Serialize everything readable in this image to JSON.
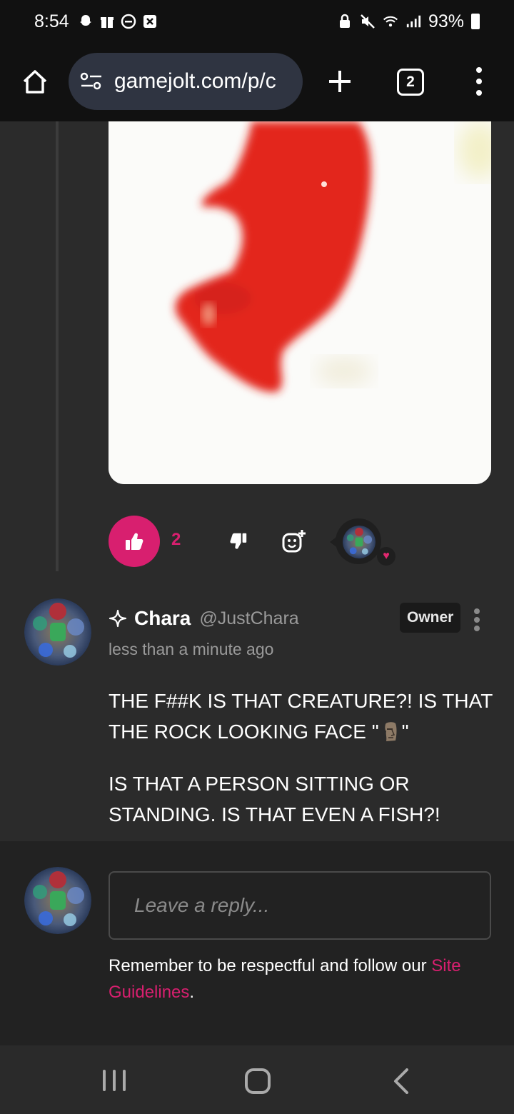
{
  "status_bar": {
    "time": "8:54",
    "left_icons": [
      "snapchat-icon",
      "gift-icon",
      "dnd-icon",
      "close-box-icon"
    ],
    "right_icons": [
      "lock-icon",
      "mute-icon",
      "wifi-icon",
      "signal-icon"
    ],
    "battery": "93%"
  },
  "browser": {
    "url": "gamejolt.com/p/c",
    "tab_count": "2"
  },
  "post": {
    "like_count": "2",
    "accent_color": "#d81f6f"
  },
  "comment": {
    "author_name": "Chara",
    "author_handle": "@JustChara",
    "badge": "Owner",
    "timestamp": "less than a minute ago",
    "paragraph1_before_emoji": "THE F##K IS THAT CREATURE?! IS THAT THE ROCK LOOKING FACE \"",
    "paragraph1_after_emoji": "\"",
    "paragraph2": "IS THAT A PERSON SITTING OR STANDING. IS THAT EVEN A FISH?!"
  },
  "reply": {
    "placeholder": "Leave a reply...",
    "guidelines_text": "Remember to be respectful and follow our ",
    "guidelines_link": "Site Guidelines",
    "guidelines_end": "."
  }
}
